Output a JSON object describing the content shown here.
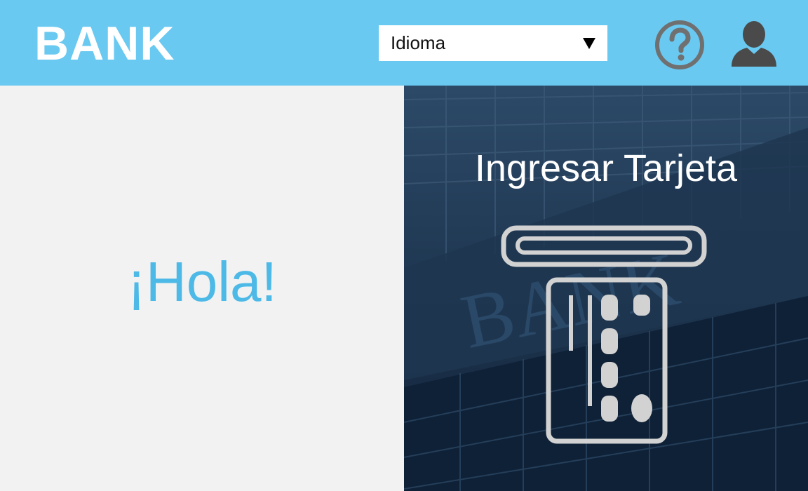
{
  "header": {
    "logo": "BANK",
    "language_select": {
      "label": "Idioma"
    },
    "help_icon": "question-circle-icon",
    "user_icon": "user-icon"
  },
  "main": {
    "greeting": "¡Hola!",
    "card_panel": {
      "title": "Ingresar Tarjeta",
      "icon": "insert-card-icon",
      "background_image": "bank-building-photo"
    }
  },
  "colors": {
    "header_bg": "#6ac9f1",
    "greeting_text": "#4db9e7",
    "left_bg": "#f2f2f2",
    "right_bg": "#172d45",
    "icon_gray": "#707070",
    "card_icon": "#d2d2d2"
  }
}
